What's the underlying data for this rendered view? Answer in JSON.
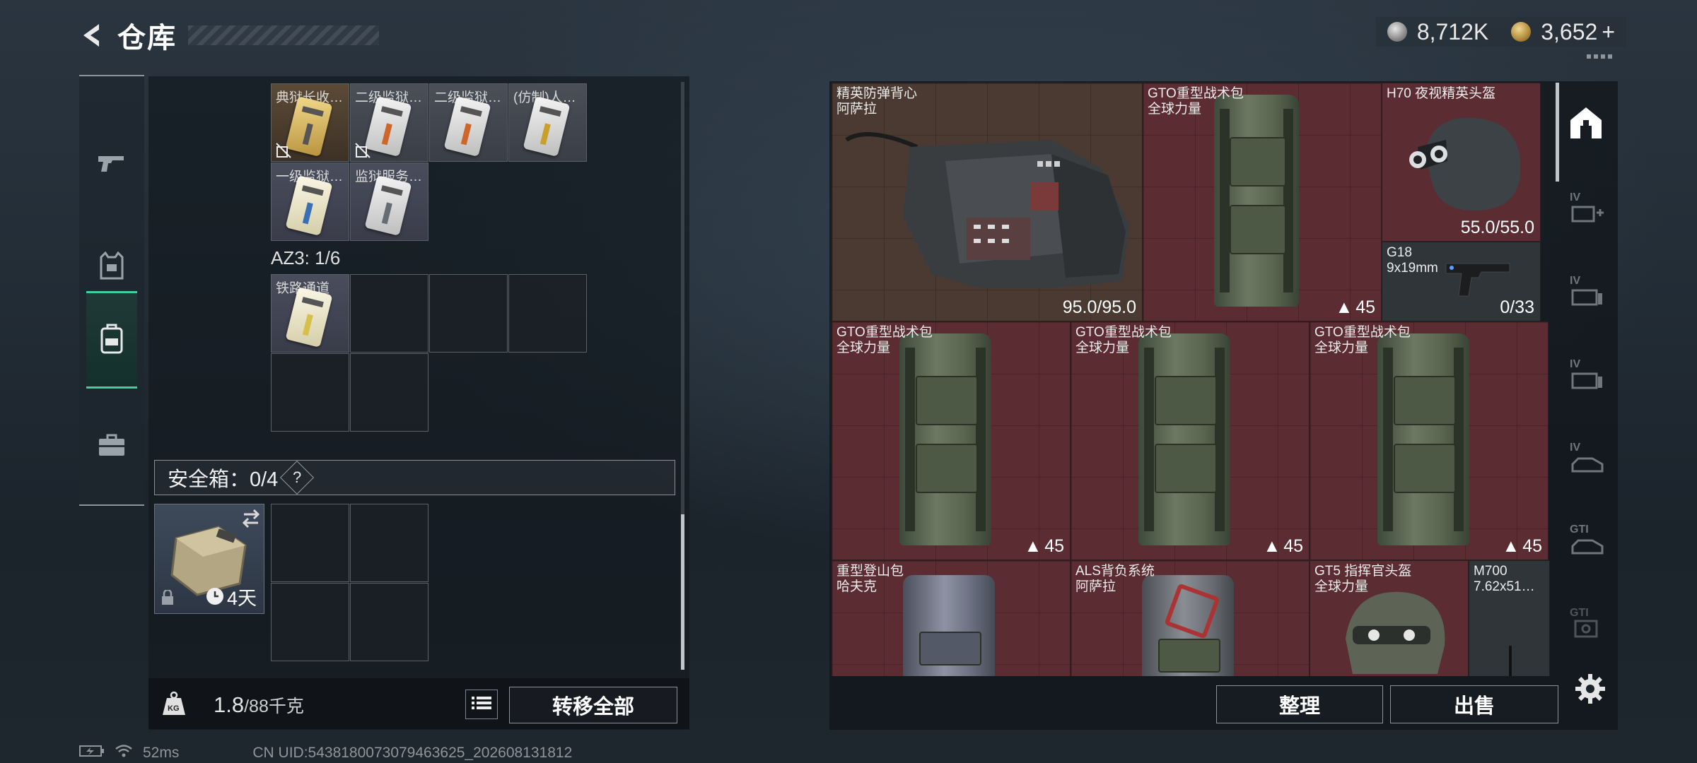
{
  "header": {
    "title": "仓库",
    "currency_silver": "8,712K",
    "currency_gold": "3,652",
    "currency_add": "+"
  },
  "side_nav": [
    {
      "name": "weapons",
      "icon": "pistol-icon"
    },
    {
      "name": "gear",
      "icon": "armor-vest-icon"
    },
    {
      "name": "backpack",
      "icon": "backpack-icon"
    },
    {
      "name": "supplies",
      "icon": "briefcase-icon"
    }
  ],
  "left_panel": {
    "key_items": [
      {
        "label": "典狱长收…",
        "color": "gold",
        "bar": "#c7a23a",
        "unbound": true
      },
      {
        "label": "二级监狱…",
        "color": "grey",
        "bar": "#d0652a",
        "unbound": true
      },
      {
        "label": "二级监狱…",
        "color": "grey",
        "bar": "#d0652a",
        "unbound": false
      },
      {
        "label": "(仿制)人…",
        "color": "grey",
        "bar": "#c9a02c",
        "unbound": false
      },
      {
        "label": "一级监狱…",
        "color": "blue",
        "bar": "#3a6fb5",
        "unbound": false
      },
      {
        "label": "监狱服务…",
        "color": "blue",
        "bar": "#666c74",
        "unbound": false
      }
    ],
    "az3_label": "AZ3: 1/6",
    "az3_items": [
      {
        "label": "铁路通道",
        "color": "blue",
        "bar": "#d6c04a"
      }
    ],
    "safe_box_title": "安全箱：0/4",
    "safe_box_help": "?",
    "safe_item_time": "4天",
    "weight_current": "1.8",
    "weight_max": "/88千克",
    "transfer_all": "转移全部"
  },
  "right_panel": {
    "items": [
      {
        "name": "精英防弹背心",
        "sub": "阿萨拉",
        "value": "95.0/95.0"
      },
      {
        "name": "GTO重型战术包",
        "sub": "全球力量",
        "count": "45"
      },
      {
        "name": "H70 夜视精英头盔",
        "sub": "",
        "value": "55.0/55.0"
      },
      {
        "name": "G18",
        "sub": "9x19mm",
        "value": "0/33"
      },
      {
        "name": "GTO重型战术包",
        "sub": "全球力量",
        "count": "45"
      },
      {
        "name": "GTO重型战术包",
        "sub": "全球力量",
        "count": "45"
      },
      {
        "name": "GTO重型战术包",
        "sub": "全球力量",
        "count": "45"
      },
      {
        "name": "重型登山包",
        "sub": "哈夫克"
      },
      {
        "name": "ALS背负系统",
        "sub": "阿萨拉"
      },
      {
        "name": "GT5 指挥官头盔",
        "sub": "全球力量"
      },
      {
        "name": "M700",
        "sub": "7.62x51…"
      }
    ],
    "sort_label": "整理",
    "sell_label": "出售",
    "tier_tabs": [
      "IV",
      "IV",
      "IV",
      "IV",
      "GTI",
      "GTI"
    ]
  },
  "status": {
    "ping": "52ms",
    "uid": "CN UID:5438180073079463625_202608131812"
  },
  "colors": {
    "accent": "#3fd0a0",
    "item_red": "#5b2c32",
    "item_brown": "#4a3a31"
  }
}
